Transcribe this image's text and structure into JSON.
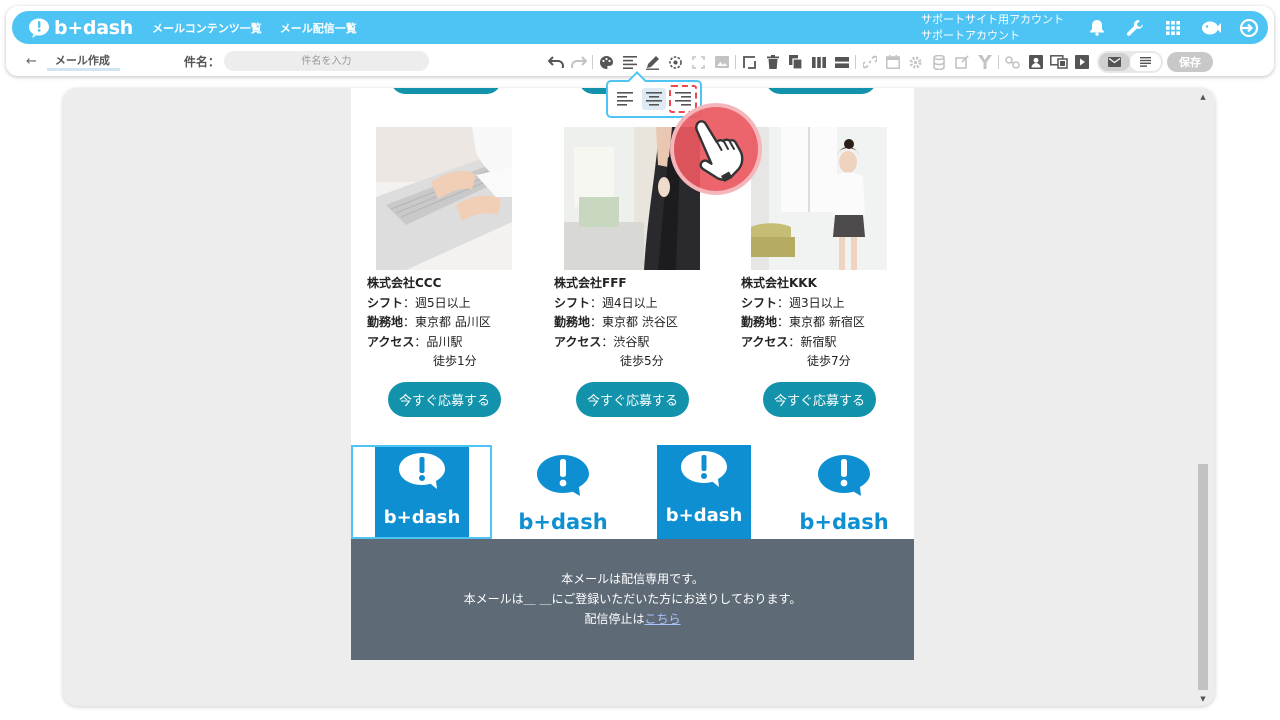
{
  "header": {
    "logo": "b+dash",
    "nav": [
      "メールコンテンツ一覧",
      "メール配信一覧"
    ],
    "account_line1": "サポートサイト用アカウント",
    "account_line2": "サポートアカウント",
    "icons": [
      "bell-icon",
      "wrench-icon",
      "grid-icon",
      "fish-icon",
      "logout-icon"
    ]
  },
  "subbar": {
    "back_label": "メール作成",
    "subject_label": "件名：",
    "subject_placeholder": "件名を入力",
    "save_label": "保存"
  },
  "toolbar": {
    "icons": [
      "undo-icon",
      "redo-icon",
      "palette-icon",
      "align-icon",
      "pen-icon",
      "target-icon",
      "expand-icon",
      "image-icon",
      "resize-icon",
      "trash-icon",
      "copy-icon",
      "columns-icon",
      "rows-icon",
      "link-icon",
      "calendar-icon",
      "database-icon",
      "edit-box-icon",
      "filter-icon",
      "connect-icon",
      "person-card-icon",
      "screens-icon",
      "play-icon"
    ],
    "mode_html": "mail-icon",
    "mode_text": "text-icon"
  },
  "align_popup": {
    "options": [
      "align-left-icon",
      "align-center-icon",
      "align-right-icon"
    ],
    "selected": "center",
    "highlighted": "right"
  },
  "email": {
    "jobs": [
      {
        "company": "株式会社CCC",
        "shift_label": "シフト",
        "shift": "週5日以上",
        "location_label": "勤務地",
        "location": "東京都 品川区",
        "access_label": "アクセス",
        "access": "品川駅",
        "walk": "徒歩1分",
        "button": "今すぐ応募する"
      },
      {
        "company": "株式会社FFF",
        "shift_label": "シフト",
        "shift": "週4日以上",
        "location_label": "勤務地",
        "location": "東京都 渋谷区",
        "access_label": "アクセス",
        "access": "渋谷駅",
        "walk": "徒歩5分",
        "button": "今すぐ応募する"
      },
      {
        "company": "株式会社KKK",
        "shift_label": "シフト",
        "shift": "週3日以上",
        "location_label": "勤務地",
        "location": "東京都 新宿区",
        "access_label": "アクセス",
        "access": "新宿駅",
        "walk": "徒歩7分",
        "button": "今すぐ応募する"
      }
    ],
    "logo_text": "b+dash",
    "footer": {
      "line1": "本メールは配信専用です。",
      "line2": "本メールは＿ ＿にご登録いただいた方にお送りしております。",
      "line3_prefix": "配信停止は",
      "line3_link": "こちら"
    }
  },
  "colors": {
    "brand": "#4ec4f5",
    "button": "#1293ab",
    "footer_bg": "#5e6b77",
    "logo_blue": "#0e8fd2"
  }
}
